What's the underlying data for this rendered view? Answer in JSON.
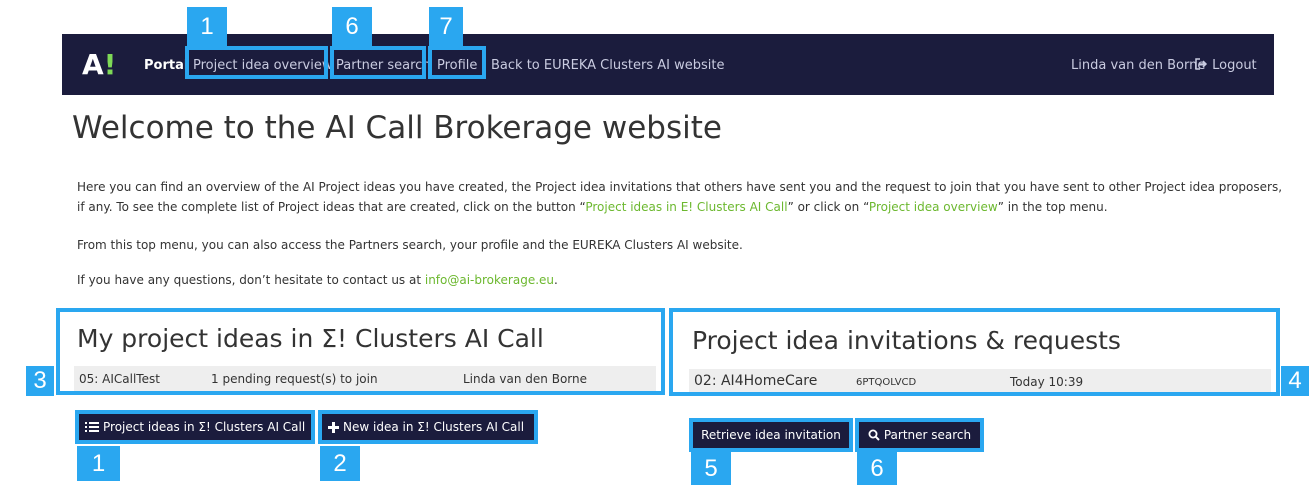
{
  "nav": {
    "logo_letter": "A",
    "logo_bang": "!",
    "portal": "Portal",
    "project_idea_overview": "Project idea overview",
    "partner_search": "Partner search",
    "profile": "Profile",
    "back_link": "Back to EUREKA Clusters AI website",
    "user_name": "Linda van den Borne",
    "logout": "Logout"
  },
  "page": {
    "title": "Welcome to the AI Call Brokerage website",
    "intro_part1": "Here you can find an overview of the AI Project ideas you have created, the Project idea invitations that others have sent you and the request to join that you have sent to other Project idea proposers, if any. To see the complete list of Project ideas that are created, click on the button “",
    "intro_link1": "Project ideas in E! Clusters AI Call",
    "intro_part2": "” or click on “",
    "intro_link2": "Project idea overview",
    "intro_part3": "” in the top menu.",
    "para2": "From this top menu, you can also access the Partners search, your profile and the EUREKA Clusters AI website.",
    "para3_text": "If you have any questions, don’t hesitate to contact us at ",
    "para3_email": "info@ai-brokerage.eu",
    "para3_end": "."
  },
  "my_ideas": {
    "title": "My project ideas in Σ! Clusters AI Call",
    "rows": [
      {
        "id": "05: AICallTest",
        "status": "1 pending request(s) to join",
        "owner": "Linda van den Borne"
      }
    ],
    "btn_list": "Project ideas in Σ! Clusters AI Call",
    "btn_new": "New idea in Σ! Clusters AI Call"
  },
  "invitations": {
    "title": "Project idea invitations & requests",
    "rows": [
      {
        "id": "02: AI4HomeCare",
        "code": "6PTQOLVCD",
        "time": "Today 10:39"
      }
    ],
    "btn_retrieve": "Retrieve idea invitation",
    "btn_search": "Partner search"
  },
  "annotations": {
    "n1_top": "1",
    "n6_top": "6",
    "n7_top": "7",
    "n3": "3",
    "n4": "4",
    "n1_bottom": "1",
    "n2": "2",
    "n5": "5",
    "n6_bottom": "6"
  },
  "colors": {
    "navbar": "#1b1c3d",
    "highlight": "#2aa7f0",
    "link_green": "#6cb82f"
  }
}
